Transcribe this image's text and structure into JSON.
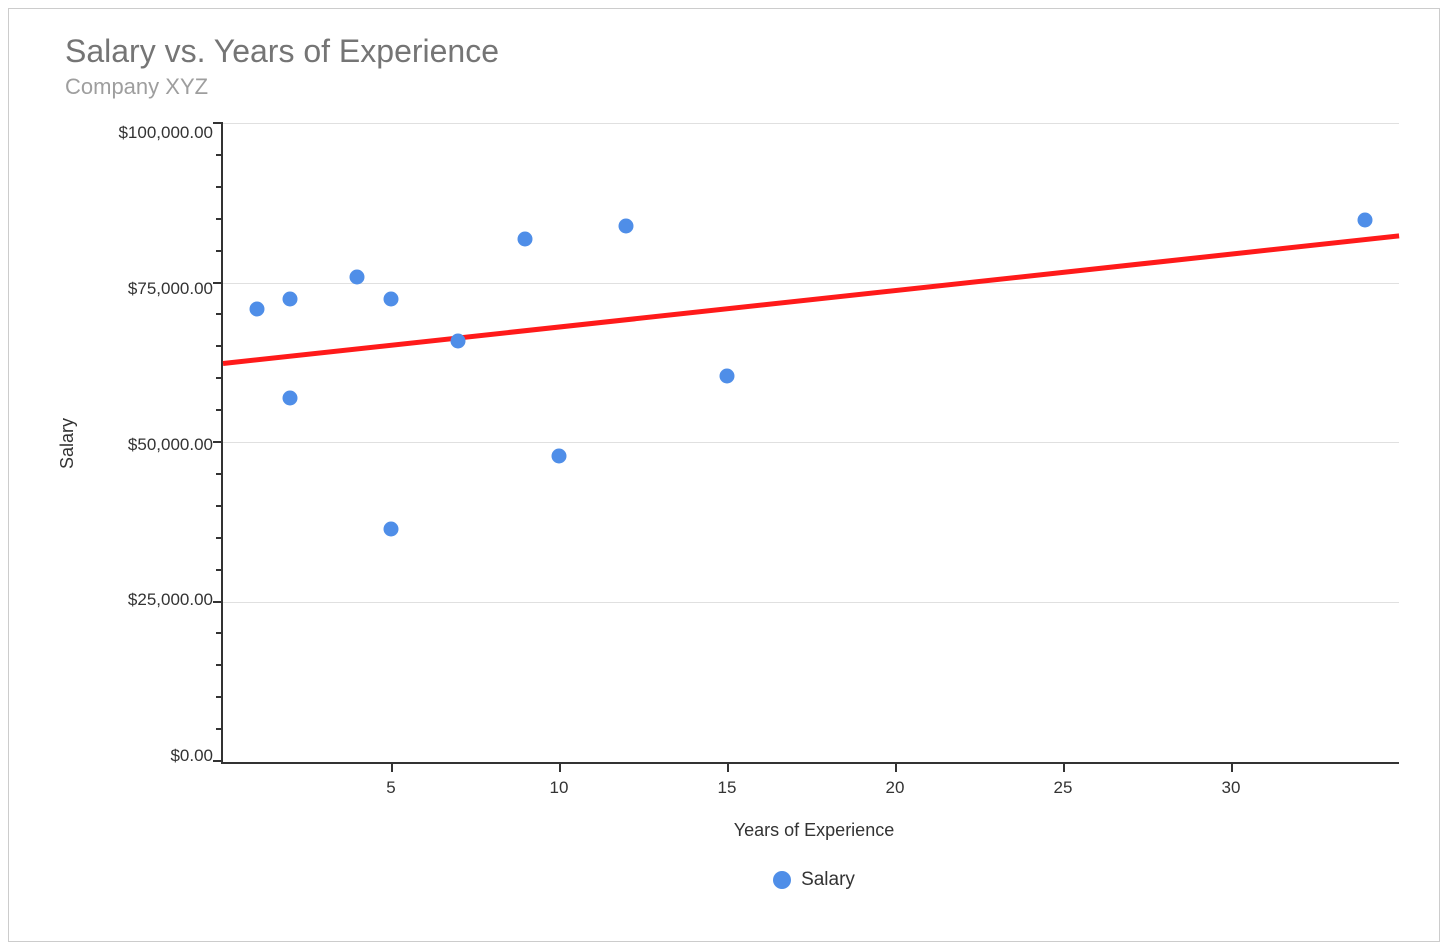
{
  "chart_data": {
    "type": "scatter",
    "title": "Salary vs. Years of Experience",
    "subtitle": "Company XYZ",
    "xlabel": "Years of Experience",
    "ylabel": "Salary",
    "xlim": [
      0,
      35
    ],
    "ylim": [
      0,
      100000
    ],
    "x_ticks": [
      5,
      10,
      15,
      20,
      25,
      30
    ],
    "y_ticks": [
      0,
      25000,
      50000,
      75000,
      100000
    ],
    "y_tick_labels": [
      "$0.00",
      "$25,000.00",
      "$50,000.00",
      "$75,000.00",
      "$100,000.00"
    ],
    "series": [
      {
        "name": "Salary",
        "color": "#4f8ee8",
        "points": [
          {
            "x": 1,
            "y": 71000
          },
          {
            "x": 2,
            "y": 72500
          },
          {
            "x": 2,
            "y": 57000
          },
          {
            "x": 4,
            "y": 76000
          },
          {
            "x": 5,
            "y": 72500
          },
          {
            "x": 5,
            "y": 36500
          },
          {
            "x": 7,
            "y": 66000
          },
          {
            "x": 9,
            "y": 82000
          },
          {
            "x": 10,
            "y": 48000
          },
          {
            "x": 12,
            "y": 84000
          },
          {
            "x": 15,
            "y": 60500
          },
          {
            "x": 34,
            "y": 85000
          }
        ]
      }
    ],
    "trendline": {
      "color": "#ff1a1a",
      "start": {
        "x": 0,
        "y": 62500
      },
      "end": {
        "x": 35,
        "y": 82500
      }
    },
    "legend": {
      "items": [
        {
          "label": "Salary",
          "color": "#4f8ee8"
        }
      ]
    }
  }
}
